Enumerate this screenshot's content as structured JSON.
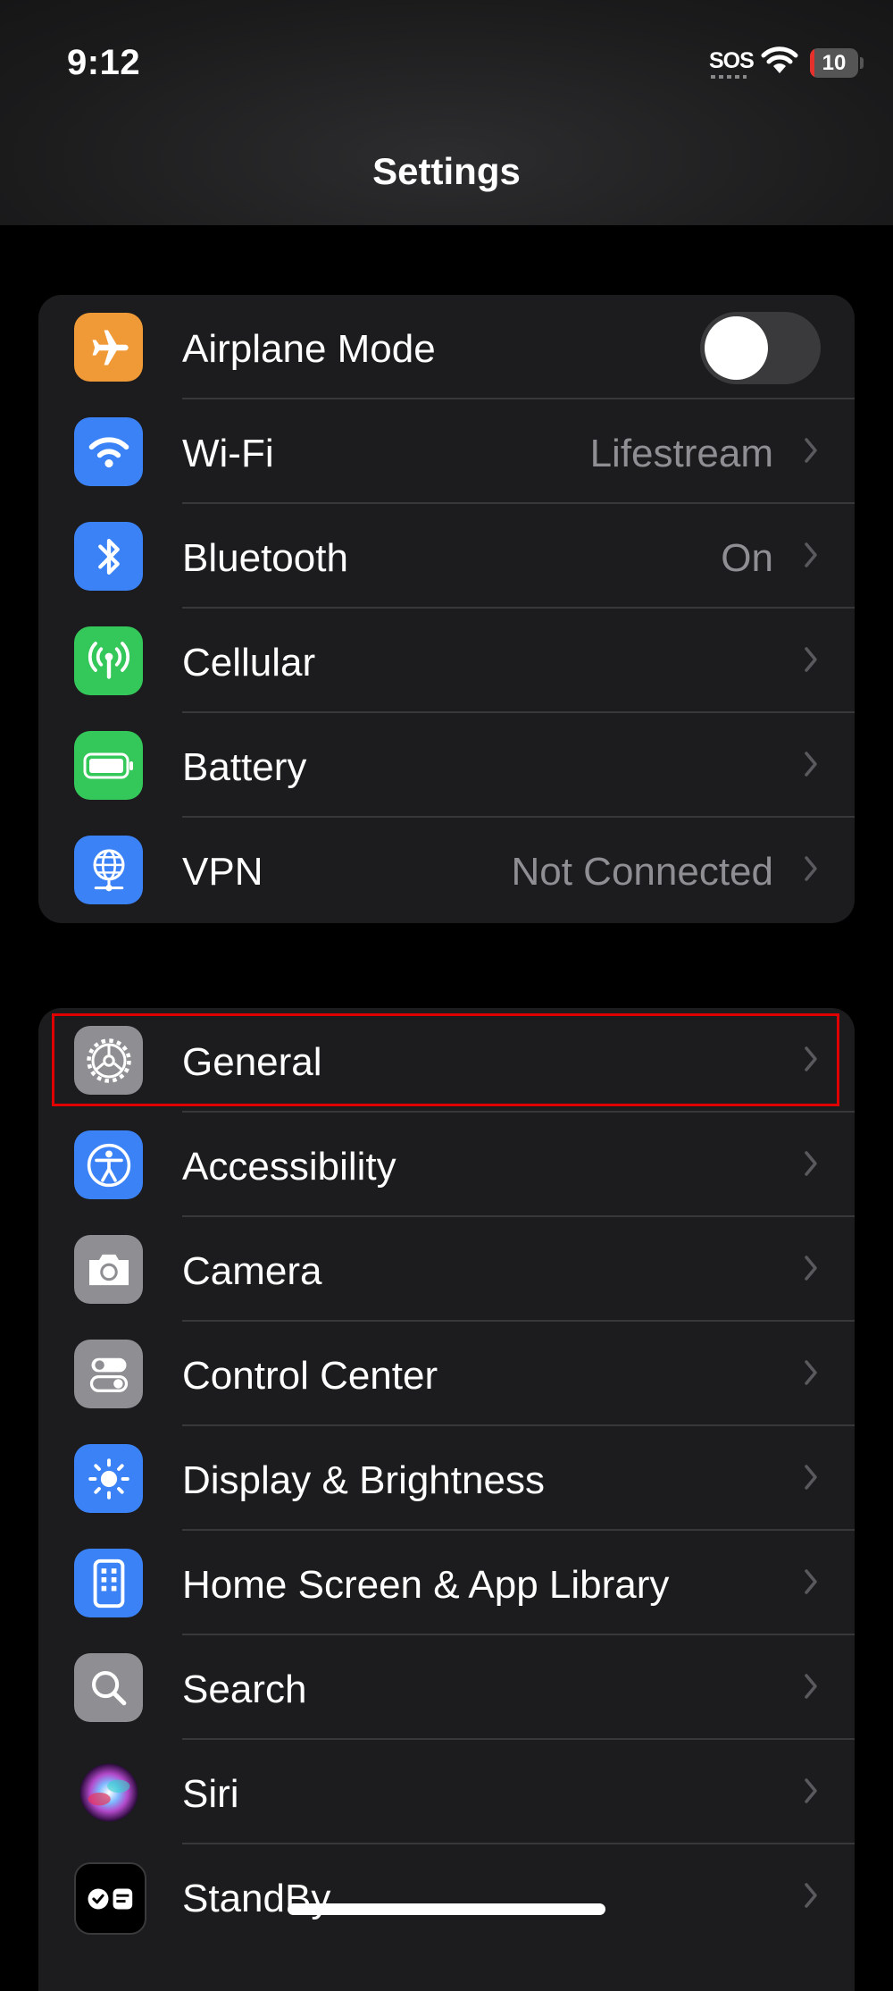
{
  "status_bar": {
    "time": "9:12",
    "sos": "SOS",
    "battery": "10",
    "battery_level": 0.1,
    "battery_fill_color": "#e5302c"
  },
  "nav": {
    "title": "Settings"
  },
  "group1": [
    {
      "label": "Airplane Mode",
      "icon": "airplane-icon",
      "icon_bg": "#f09a37",
      "toggle": false
    },
    {
      "label": "Wi-Fi",
      "value": "Lifestream",
      "icon": "wifi-icon",
      "icon_bg": "#3b82f6"
    },
    {
      "label": "Bluetooth",
      "value": "On",
      "icon": "bluetooth-icon",
      "icon_bg": "#3b82f6"
    },
    {
      "label": "Cellular",
      "icon": "cellular-antenna-icon",
      "icon_bg": "#34c759"
    },
    {
      "label": "Battery",
      "icon": "battery-icon",
      "icon_bg": "#34c759"
    },
    {
      "label": "VPN",
      "value": "Not Connected",
      "icon": "vpn-globe-icon",
      "icon_bg": "#3b82f6"
    }
  ],
  "group2": [
    {
      "label": "General",
      "icon": "gear-icon",
      "icon_bg": "#8e8e93",
      "highlighted": true
    },
    {
      "label": "Accessibility",
      "icon": "accessibility-icon",
      "icon_bg": "#3b82f6"
    },
    {
      "label": "Camera",
      "icon": "camera-icon",
      "icon_bg": "#8e8e93"
    },
    {
      "label": "Control Center",
      "icon": "control-center-icon",
      "icon_bg": "#8e8e93"
    },
    {
      "label": "Display & Brightness",
      "icon": "sun-icon",
      "icon_bg": "#3b82f6"
    },
    {
      "label": "Home Screen & App Library",
      "icon": "home-screen-icon",
      "icon_bg": "#3b82f6"
    },
    {
      "label": "Search",
      "icon": "search-icon",
      "icon_bg": "#8e8e93"
    },
    {
      "label": "Siri",
      "icon": "siri-icon",
      "icon_bg": "#1c1c1e"
    },
    {
      "label": "StandBy",
      "icon": "standby-icon",
      "icon_bg": "#000000"
    }
  ],
  "highlight_color": "#e10000"
}
